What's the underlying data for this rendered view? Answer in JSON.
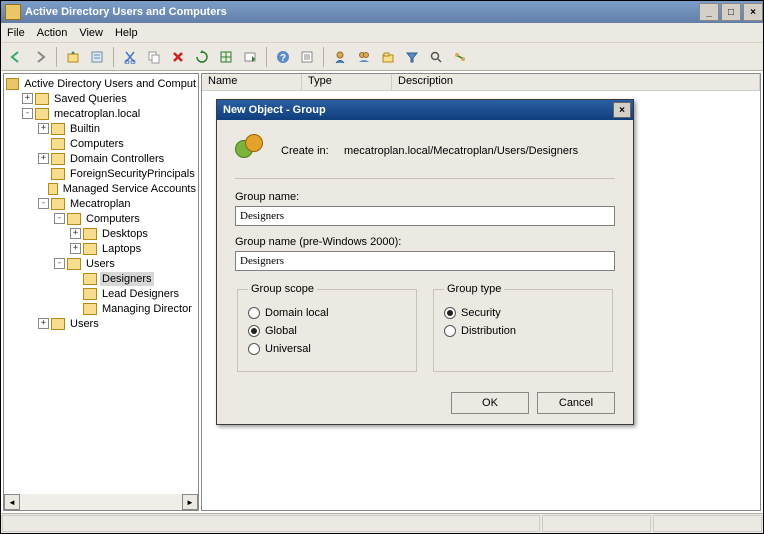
{
  "window": {
    "title": "Active Directory Users and Computers",
    "menu": [
      "File",
      "Action",
      "View",
      "Help"
    ]
  },
  "toolbar_icons": [
    "back",
    "forward",
    "up",
    "props",
    "cut",
    "copy",
    "delete",
    "refresh",
    "grid",
    "exec",
    "help",
    "list",
    "user",
    "users",
    "folder",
    "filter",
    "find",
    "transfer"
  ],
  "tree": {
    "root": "Active Directory Users and Comput",
    "nodes": [
      {
        "indent": 1,
        "tog": "+",
        "label": "Saved Queries"
      },
      {
        "indent": 1,
        "tog": "-",
        "label": "mecatroplan.local"
      },
      {
        "indent": 2,
        "tog": "+",
        "label": "Builtin"
      },
      {
        "indent": 2,
        "tog": " ",
        "label": "Computers"
      },
      {
        "indent": 2,
        "tog": "+",
        "label": "Domain Controllers"
      },
      {
        "indent": 2,
        "tog": " ",
        "label": "ForeignSecurityPrincipals"
      },
      {
        "indent": 2,
        "tog": " ",
        "label": "Managed Service Accounts"
      },
      {
        "indent": 2,
        "tog": "-",
        "label": "Mecatroplan"
      },
      {
        "indent": 3,
        "tog": "-",
        "label": "Computers"
      },
      {
        "indent": 4,
        "tog": "+",
        "label": "Desktops"
      },
      {
        "indent": 4,
        "tog": "+",
        "label": "Laptops"
      },
      {
        "indent": 3,
        "tog": "-",
        "label": "Users"
      },
      {
        "indent": 4,
        "tog": " ",
        "label": "Designers",
        "selected": true
      },
      {
        "indent": 4,
        "tog": " ",
        "label": "Lead Designers"
      },
      {
        "indent": 4,
        "tog": " ",
        "label": "Managing Director"
      },
      {
        "indent": 2,
        "tog": "+",
        "label": "Users"
      }
    ]
  },
  "list": {
    "columns": [
      "Name",
      "Type",
      "Description"
    ]
  },
  "dialog": {
    "title": "New Object - Group",
    "create_in_label": "Create in:",
    "create_in_path": "mecatroplan.local/Mecatroplan/Users/Designers",
    "group_name_label": "Group name:",
    "group_name_value": "Designers",
    "group_name_pre2000_label": "Group name (pre-Windows 2000):",
    "group_name_pre2000_value": "Designers",
    "scope_legend": "Group scope",
    "scope_options": [
      {
        "label": "Domain local",
        "checked": false
      },
      {
        "label": "Global",
        "checked": true
      },
      {
        "label": "Universal",
        "checked": false
      }
    ],
    "type_legend": "Group type",
    "type_options": [
      {
        "label": "Security",
        "checked": true
      },
      {
        "label": "Distribution",
        "checked": false
      }
    ],
    "ok_label": "OK",
    "cancel_label": "Cancel"
  }
}
